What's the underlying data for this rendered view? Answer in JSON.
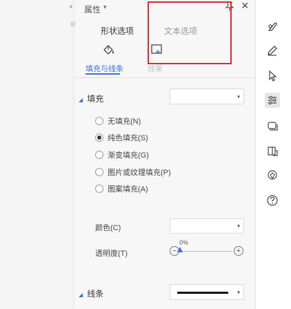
{
  "header": {
    "title": "属性",
    "caret": "▾",
    "pin_icon": "pin-icon",
    "close_symbol": "×"
  },
  "tabs": [
    {
      "label": "形状选项",
      "active": true
    },
    {
      "label": "文本选项",
      "active": false
    }
  ],
  "subtabs": [
    {
      "label": "填充与线条",
      "icon": "paint-bucket-icon",
      "active": true
    },
    {
      "label": "效果",
      "icon": "effects-icon",
      "active": false
    }
  ],
  "fill_section": {
    "title": "填充",
    "dropdown_value": "",
    "options": [
      {
        "label": "无填充(N)",
        "checked": false
      },
      {
        "label": "纯色填充(S)",
        "checked": true
      },
      {
        "label": "渐变填充(G)",
        "checked": false
      },
      {
        "label": "图片或纹理填充(P)",
        "checked": false
      },
      {
        "label": "图案填充(A)",
        "checked": false
      }
    ],
    "color_label": "颜色(C)",
    "transparency_label": "透明度(T)",
    "transparency_value": "0%",
    "transparency_fraction": 0,
    "minus_symbol": "−",
    "plus_symbol": "+"
  },
  "line_section": {
    "title": "线条"
  },
  "right_toolbar": {
    "icons": [
      "style-icon",
      "pen-icon",
      "cursor-icon",
      "properties-icon",
      "layers-icon",
      "crop-icon",
      "location-icon",
      "help-icon"
    ],
    "active_index": 3
  },
  "left_strip": {
    "arrow": "▴"
  },
  "colors": {
    "accent": "#3a6fd6",
    "highlight": "#e0262b",
    "panel_bg": "#f7f7f7"
  }
}
